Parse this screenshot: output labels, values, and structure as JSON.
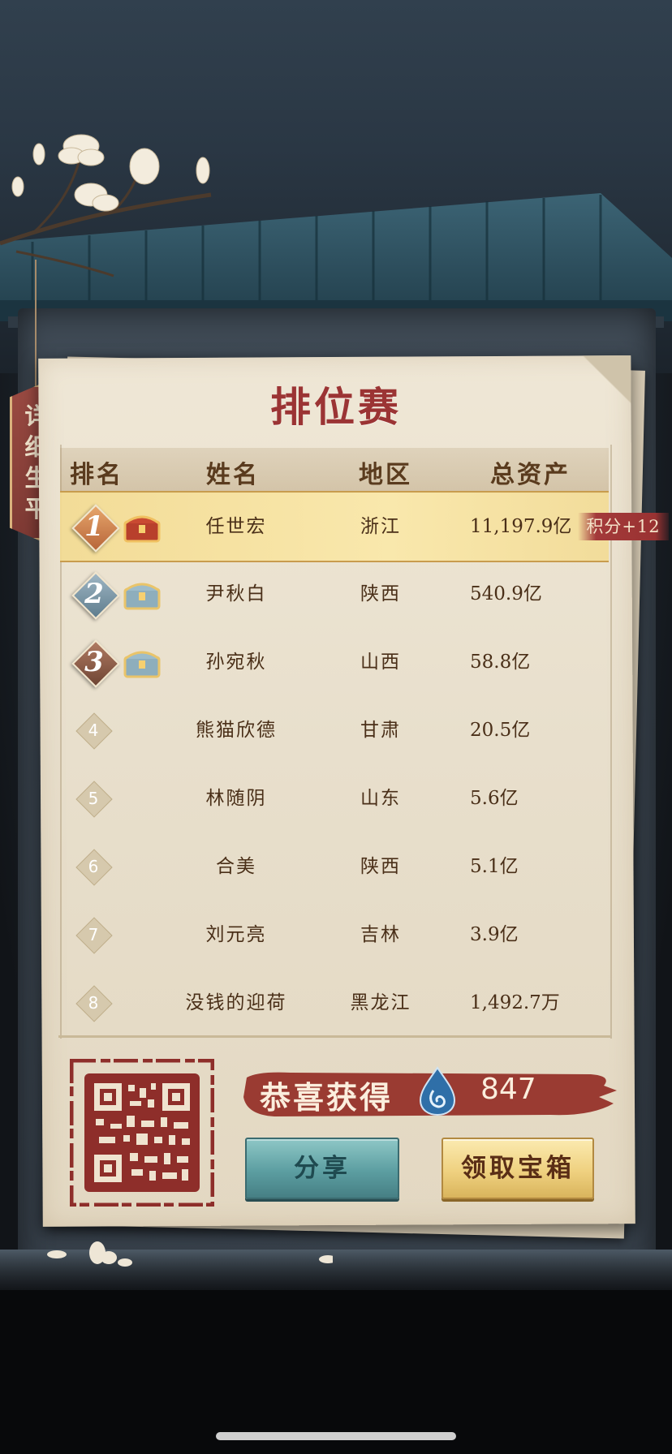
{
  "title": "排位赛",
  "side_tag": [
    "详",
    "细",
    "生",
    "平"
  ],
  "headers": {
    "rank": "排名",
    "name": "姓名",
    "region": "地区",
    "assets": "总资产"
  },
  "rows": [
    {
      "rank": "1",
      "name": "任世宏",
      "region": "浙江",
      "assets": "11,197.9亿",
      "medal": "gold"
    },
    {
      "rank": "2",
      "name": "尹秋白",
      "region": "陕西",
      "assets": "540.9亿",
      "medal": "silver"
    },
    {
      "rank": "3",
      "name": "孙宛秋",
      "region": "山西",
      "assets": "58.8亿",
      "medal": "bronze"
    },
    {
      "rank": "4",
      "name": "熊猫欣德",
      "region": "甘肃",
      "assets": "20.5亿"
    },
    {
      "rank": "5",
      "name": "林随阴",
      "region": "山东",
      "assets": "5.6亿"
    },
    {
      "rank": "6",
      "name": "合美",
      "region": "陕西",
      "assets": "5.1亿"
    },
    {
      "rank": "7",
      "name": "刘元亮",
      "region": "吉林",
      "assets": "3.9亿"
    },
    {
      "rank": "8",
      "name": "没钱的迎荷",
      "region": "黑龙江",
      "assets": "1,492.7万"
    }
  ],
  "score_tag": "积分+12",
  "reward": {
    "label": "恭喜获得",
    "amount": "847",
    "icon": "water-drop-icon"
  },
  "buttons": {
    "share": "分享",
    "claim": "领取宝箱"
  },
  "colors": {
    "title": "#9b3434",
    "highlight": "#f3db91",
    "banner": "#9a3b32"
  }
}
